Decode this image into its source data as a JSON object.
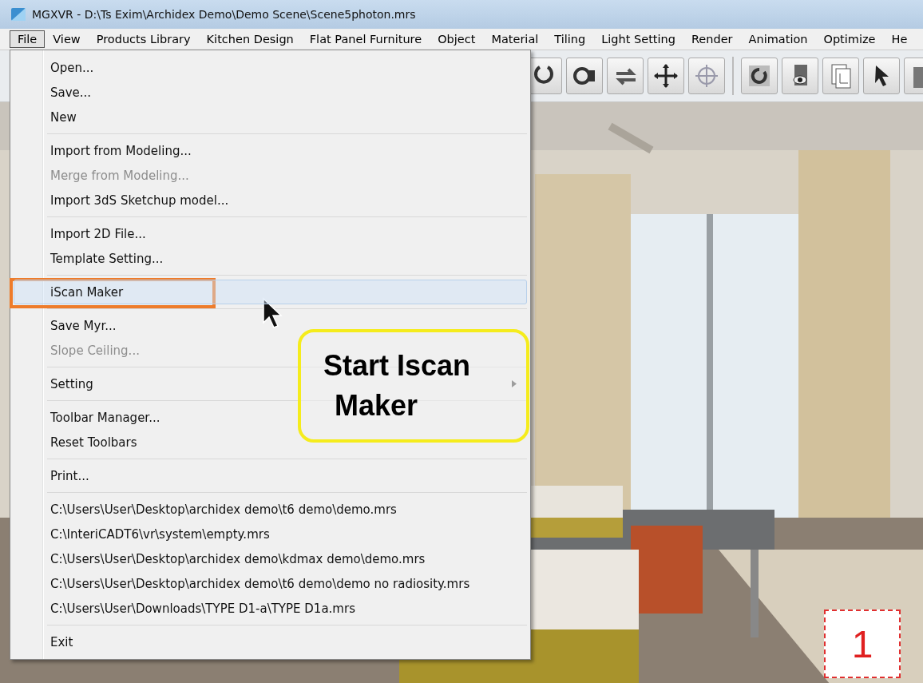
{
  "window": {
    "title": "MGXVR - D:\\Ts Exim\\Archidex Demo\\Demo Scene\\Scene5photon.mrs"
  },
  "menu_bar": [
    {
      "label": "File",
      "selected": true
    },
    {
      "label": "View",
      "selected": false
    },
    {
      "label": "Products Library",
      "selected": false
    },
    {
      "label": "Kitchen Design",
      "selected": false
    },
    {
      "label": "Flat Panel Furniture",
      "selected": false
    },
    {
      "label": "Object",
      "selected": false
    },
    {
      "label": "Material",
      "selected": false
    },
    {
      "label": "Tiling",
      "selected": false
    },
    {
      "label": "Light Setting",
      "selected": false
    },
    {
      "label": "Render",
      "selected": false
    },
    {
      "label": "Animation",
      "selected": false
    },
    {
      "label": "Optimize",
      "selected": false
    },
    {
      "label": "He",
      "selected": false
    }
  ],
  "file_menu": {
    "groups": [
      [
        {
          "label": "Open...",
          "disabled": false,
          "selected": false,
          "submenu": false
        },
        {
          "label": "Save...",
          "disabled": false,
          "selected": false,
          "submenu": false
        },
        {
          "label": "New",
          "disabled": false,
          "selected": false,
          "submenu": false
        }
      ],
      [
        {
          "label": "Import from Modeling...",
          "disabled": false,
          "selected": false,
          "submenu": false
        },
        {
          "label": "Merge from Modeling...",
          "disabled": true,
          "selected": false,
          "submenu": false
        },
        {
          "label": "Import 3dS  Sketchup model...",
          "disabled": false,
          "selected": false,
          "submenu": false
        }
      ],
      [
        {
          "label": "Import 2D File...",
          "disabled": false,
          "selected": false,
          "submenu": false
        },
        {
          "label": "Template Setting...",
          "disabled": false,
          "selected": false,
          "submenu": false
        }
      ],
      [
        {
          "label": "iScan Maker",
          "disabled": false,
          "selected": true,
          "submenu": false
        }
      ],
      [
        {
          "label": "Save Myr...",
          "disabled": false,
          "selected": false,
          "submenu": false
        },
        {
          "label": "Slope Ceiling...",
          "disabled": true,
          "selected": false,
          "submenu": false
        }
      ],
      [
        {
          "label": "Setting",
          "disabled": false,
          "selected": false,
          "submenu": true
        }
      ],
      [
        {
          "label": "Toolbar Manager...",
          "disabled": false,
          "selected": false,
          "submenu": false
        },
        {
          "label": "Reset Toolbars",
          "disabled": false,
          "selected": false,
          "submenu": false
        }
      ],
      [
        {
          "label": "Print...",
          "disabled": false,
          "selected": false,
          "submenu": false
        }
      ],
      [
        {
          "label": "C:\\Users\\User\\Desktop\\archidex demo\\t6 demo\\demo.mrs",
          "disabled": false,
          "selected": false,
          "submenu": false
        },
        {
          "label": "C:\\InteriCADT6\\vr\\system\\empty.mrs",
          "disabled": false,
          "selected": false,
          "submenu": false
        },
        {
          "label": "C:\\Users\\User\\Desktop\\archidex demo\\kdmax demo\\demo.mrs",
          "disabled": false,
          "selected": false,
          "submenu": false
        },
        {
          "label": "C:\\Users\\User\\Desktop\\archidex demo\\t6 demo\\demo no radiosity.mrs",
          "disabled": false,
          "selected": false,
          "submenu": false
        },
        {
          "label": "C:\\Users\\User\\Downloads\\TYPE D1-a\\TYPE D1a.mrs",
          "disabled": false,
          "selected": false,
          "submenu": false
        }
      ],
      [
        {
          "label": "Exit",
          "disabled": false,
          "selected": false,
          "submenu": false
        }
      ]
    ]
  },
  "callout": {
    "lines": [
      "Start Iscan",
      "Maker"
    ]
  },
  "step_badge": "1"
}
